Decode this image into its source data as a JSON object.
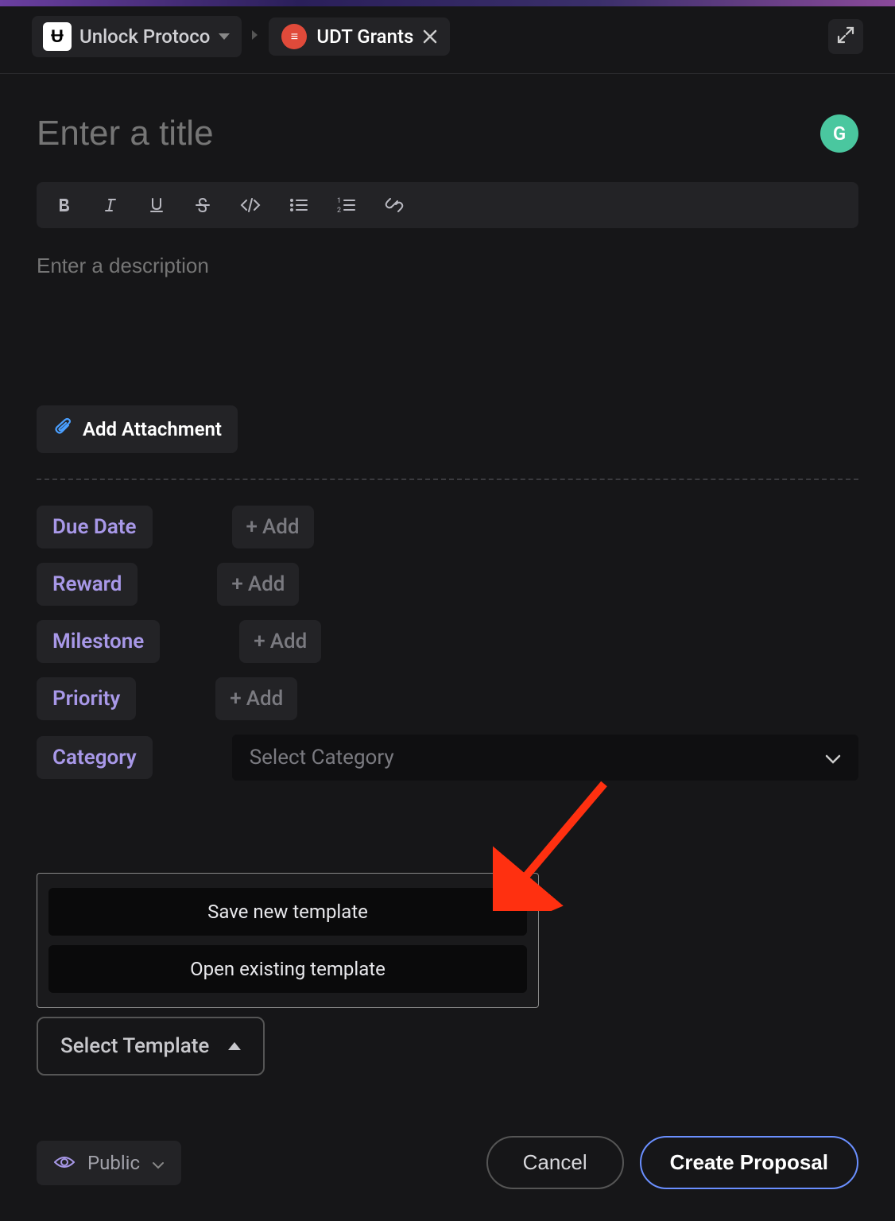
{
  "header": {
    "breadcrumb": "Unlock Protoco",
    "tab": "UDT Grants"
  },
  "title_placeholder": "Enter a title",
  "description_placeholder": "Enter a description",
  "g_badge": "G",
  "attachment_label": "Add Attachment",
  "fields": {
    "due_date": {
      "label": "Due Date",
      "action": "Add"
    },
    "reward": {
      "label": "Reward",
      "action": "Add"
    },
    "milestone": {
      "label": "Milestone",
      "action": "Add"
    },
    "priority": {
      "label": "Priority",
      "action": "Add"
    },
    "category": {
      "label": "Category",
      "placeholder": "Select Category"
    }
  },
  "template_popup": {
    "save": "Save new template",
    "open": "Open existing template"
  },
  "template_button": "Select Template",
  "footer": {
    "visibility": "Public",
    "cancel": "Cancel",
    "create": "Create Proposal"
  },
  "annotation": {
    "highlight_target": "open-existing-template"
  }
}
